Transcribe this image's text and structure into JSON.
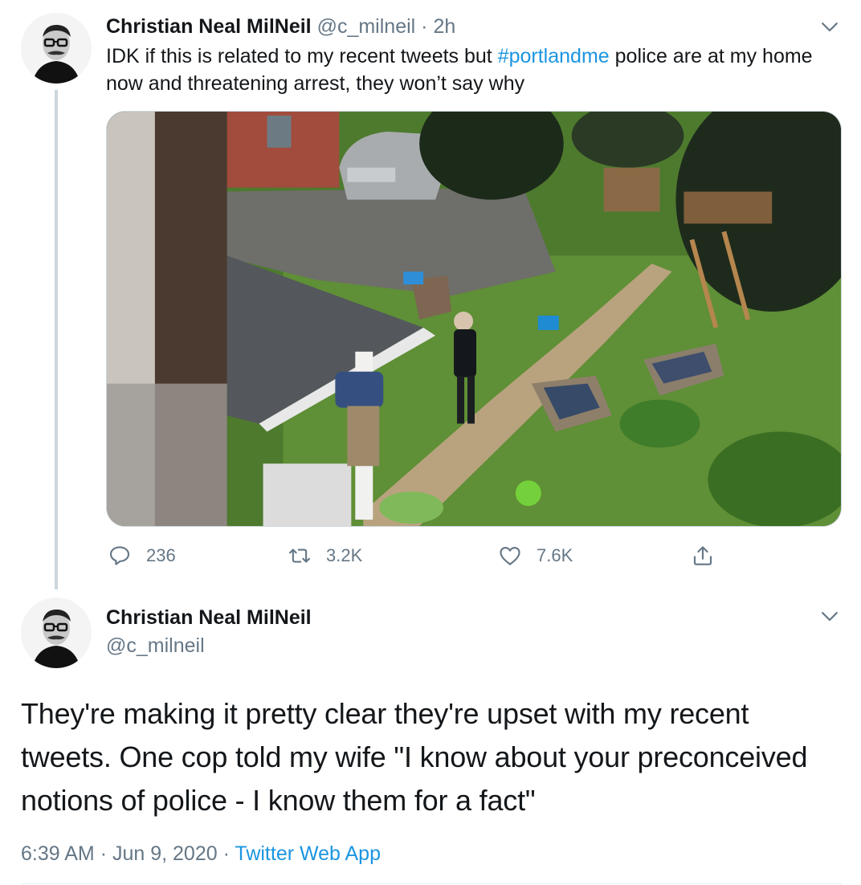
{
  "tweet1": {
    "name": "Christian Neal MilNeil",
    "handle": "@c_milneil",
    "separator": "·",
    "time": "2h",
    "text_before": "IDK if this is related to my recent tweets but ",
    "hashtag": "#portlandme",
    "text_after": " police are at my home now and threatening arrest, they won’t say why",
    "actions": {
      "replies": "236",
      "retweets": "3.2K",
      "likes": "7.6K"
    }
  },
  "tweet2": {
    "name": "Christian Neal MilNeil",
    "handle": "@c_milneil",
    "text": "They're making it pretty clear they're upset with my recent tweets. One cop told my wife \"I know about your preconceived notions of police - I know them for a fact\"",
    "time": "6:39 AM",
    "dot1": "·",
    "date": "Jun 9, 2020",
    "dot2": "·",
    "source": "Twitter Web App"
  },
  "icons": {
    "reply": "reply-icon",
    "retweet": "retweet-icon",
    "like": "heart-icon",
    "share": "share-icon",
    "menu": "chevron-down-icon"
  },
  "colors": {
    "link": "#1b95e0",
    "secondary": "#657786",
    "text": "#14171a",
    "thread_line": "#ccd6dd"
  }
}
